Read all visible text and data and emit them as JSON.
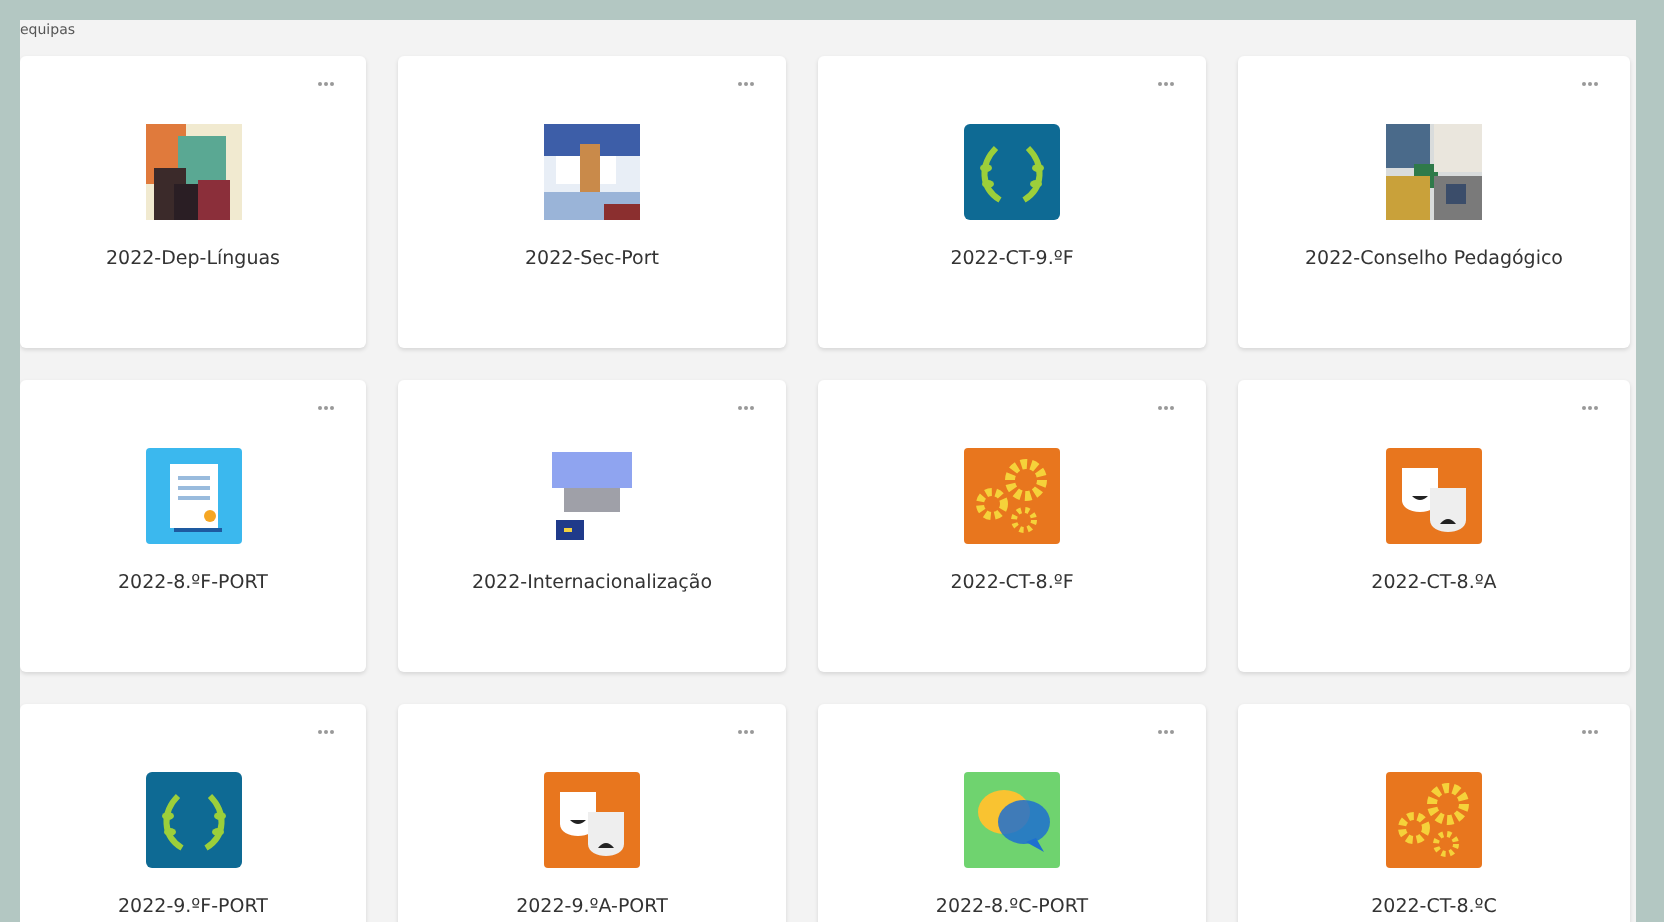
{
  "header": {
    "label": "equipas"
  },
  "teams": [
    {
      "name": "2022-Dep-Línguas",
      "kind": "picture"
    },
    {
      "name": "2022-Sec-Port",
      "kind": "picture"
    },
    {
      "name": "2022-CT-9.ºF",
      "kind": "laurel"
    },
    {
      "name": "2022-Conselho Pedagógico",
      "kind": "picture"
    },
    {
      "name": "2022-8.ºF-PORT",
      "kind": "document"
    },
    {
      "name": "2022-Internacionalização",
      "kind": "picture"
    },
    {
      "name": "2022-CT-8.ºF",
      "kind": "gears"
    },
    {
      "name": "2022-CT-8.ºA",
      "kind": "masks"
    },
    {
      "name": "2022-9.ºF-PORT",
      "kind": "laurel"
    },
    {
      "name": "2022-9.ºA-PORT",
      "kind": "masks"
    },
    {
      "name": "2022-8.ºC-PORT",
      "kind": "chat"
    },
    {
      "name": "2022-CT-8.ºC",
      "kind": "gears"
    }
  ]
}
